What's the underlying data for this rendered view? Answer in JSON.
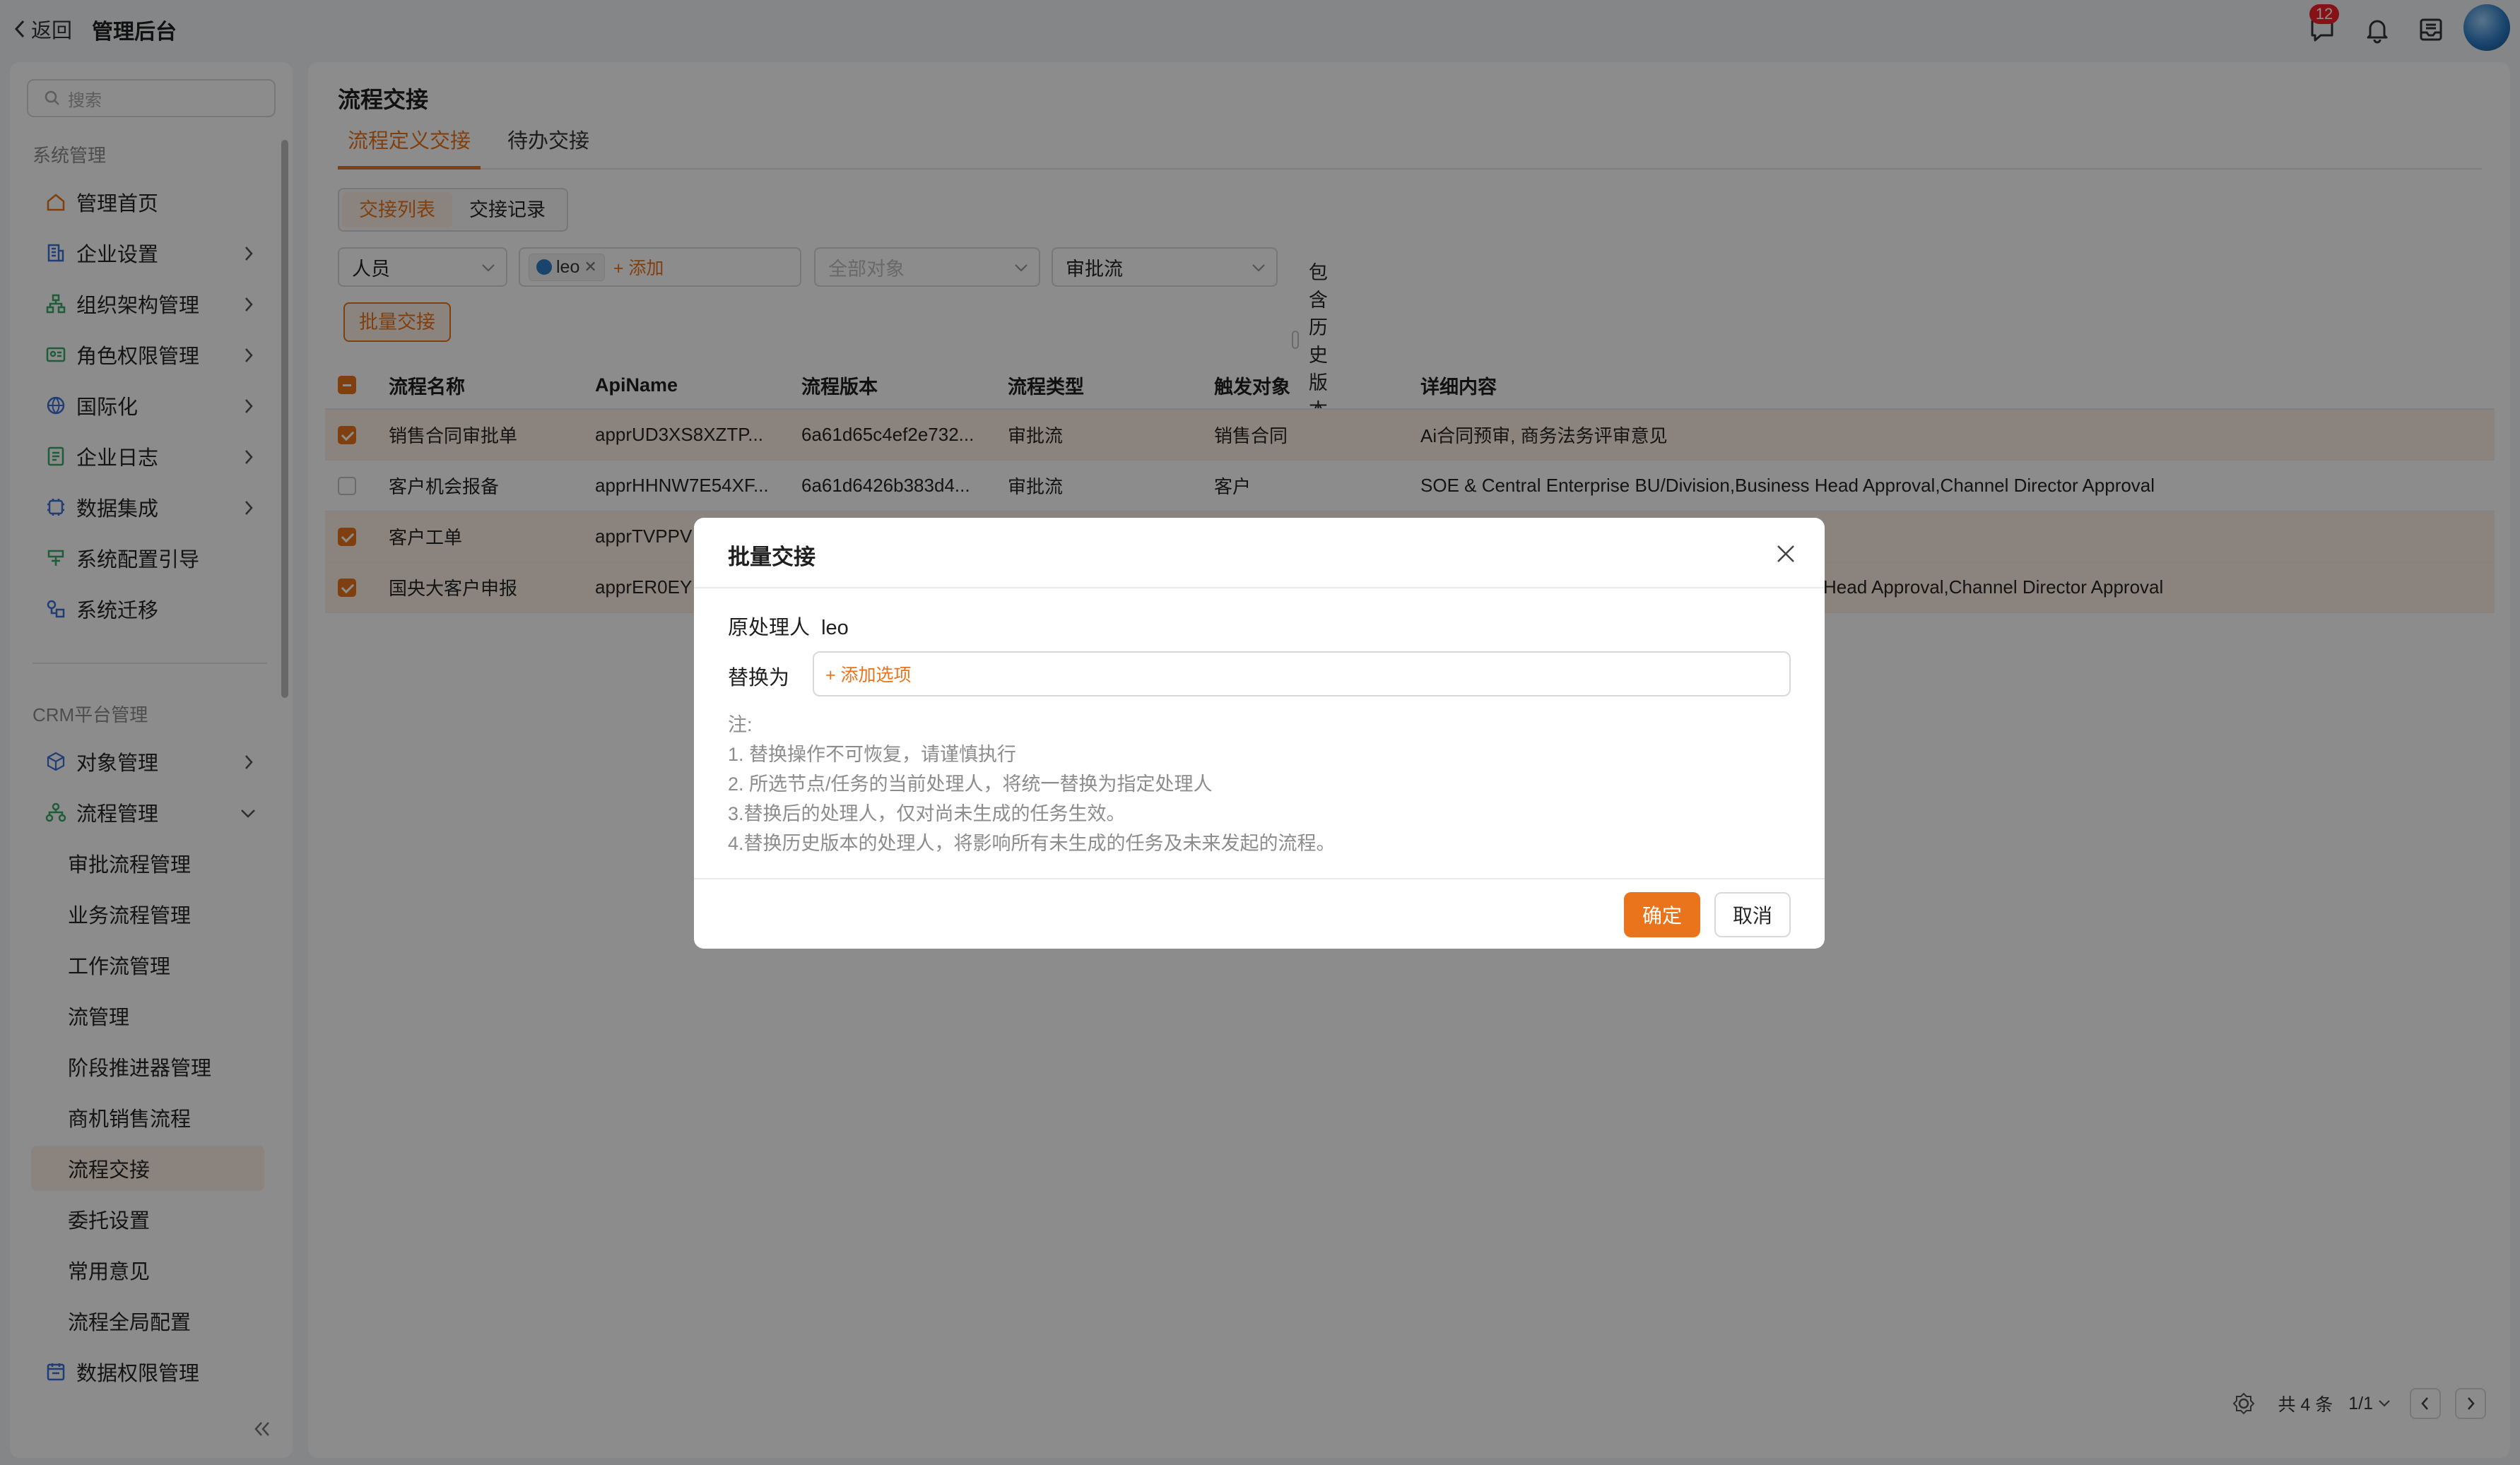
{
  "topbar": {
    "back_label": "返回",
    "title": "管理后台",
    "message_badge": "12",
    "icons": [
      "message-icon",
      "bell-icon",
      "inbox-icon",
      "avatar"
    ]
  },
  "sidebar": {
    "search_placeholder": "搜索",
    "system_group": "系统管理",
    "system_items": [
      {
        "label": "管理首页",
        "icon": "home-icon",
        "expandable": false
      },
      {
        "label": "企业设置",
        "icon": "building-icon",
        "expandable": true
      },
      {
        "label": "组织架构管理",
        "icon": "org-icon",
        "expandable": true
      },
      {
        "label": "角色权限管理",
        "icon": "id-card-icon",
        "expandable": true
      },
      {
        "label": "国际化",
        "icon": "globe-icon",
        "expandable": true
      },
      {
        "label": "企业日志",
        "icon": "log-icon",
        "expandable": true
      },
      {
        "label": "数据集成",
        "icon": "integration-icon",
        "expandable": true
      },
      {
        "label": "系统配置引导",
        "icon": "guide-icon",
        "expandable": false
      },
      {
        "label": "系统迁移",
        "icon": "migrate-icon",
        "expandable": false
      }
    ],
    "crm_group": "CRM平台管理",
    "crm_items": [
      {
        "label": "对象管理",
        "icon": "cube-icon",
        "expandable": true
      },
      {
        "label": "流程管理",
        "icon": "flow-icon",
        "expandable": true
      }
    ],
    "flow_sub_items": [
      "审批流程管理",
      "业务流程管理",
      "工作流管理",
      "流管理",
      "阶段推进器管理",
      "商机销售流程",
      "流程交接",
      "委托设置",
      "常用意见",
      "流程全局配置"
    ],
    "active_sub": "流程交接",
    "last_item": {
      "label": "数据权限管理",
      "icon": "data-permission-icon"
    }
  },
  "main": {
    "page_title": "流程交接",
    "tabs": [
      "流程定义交接",
      "待办交接"
    ],
    "active_tab": 0,
    "segments": [
      "交接列表",
      "交接记录"
    ],
    "active_segment": 0,
    "filters": {
      "person_select": "人员",
      "tag_value": "leo",
      "add_label": "+ 添加",
      "object_placeholder": "全部对象",
      "flow_type": "审批流",
      "include_history": "包含历史版本"
    },
    "batch_button": "批量交接",
    "table": {
      "headers": [
        "流程名称",
        "ApiName",
        "流程版本",
        "流程类型",
        "触发对象",
        "详细内容"
      ],
      "rows": [
        {
          "checked": true,
          "cells": [
            "销售合同审批单",
            "apprUD3XS8XZTP...",
            "6a61d65c4ef2e732...",
            "审批流",
            "销售合同",
            "Ai合同预审, 商务法务评审意见"
          ]
        },
        {
          "checked": false,
          "cells": [
            "客户机会报备",
            "apprHHNW7E54XF...",
            "6a61d6426b383d4...",
            "审批流",
            "客户",
            "SOE & Central Enterprise BU/Division,Business Head Approval,Channel Director Approval"
          ]
        },
        {
          "checked": true,
          "cells": [
            "客户工单",
            "apprTVPPV",
            "",
            "",
            "",
            ""
          ]
        },
        {
          "checked": true,
          "cells": [
            "国央大客户申报",
            "apprER0EY",
            "",
            "",
            "",
            "Head Approval,Channel Director Approval"
          ]
        }
      ]
    },
    "pager": {
      "total": "共 4 条",
      "page": "1/1"
    }
  },
  "modal": {
    "title": "批量交接",
    "original_label": "原处理人",
    "original_value": "leo",
    "replace_label": "替换为",
    "add_option": "+ 添加选项",
    "notes": [
      "注:",
      "1. 替换操作不可恢复，请谨慎执行",
      "2. 所选节点/任务的当前处理人，将统一替换为指定处理人",
      "3.替换后的处理人，仅对尚未生成的任务生效。",
      "4.替换历史版本的处理人，将影响所有未生成的任务及未来发起的流程。"
    ],
    "ok": "确定",
    "cancel": "取消"
  },
  "colors": {
    "accent": "#e9741b",
    "accent_light": "#fdf1e6",
    "overlay": "rgba(0,0,0,0.45)"
  }
}
